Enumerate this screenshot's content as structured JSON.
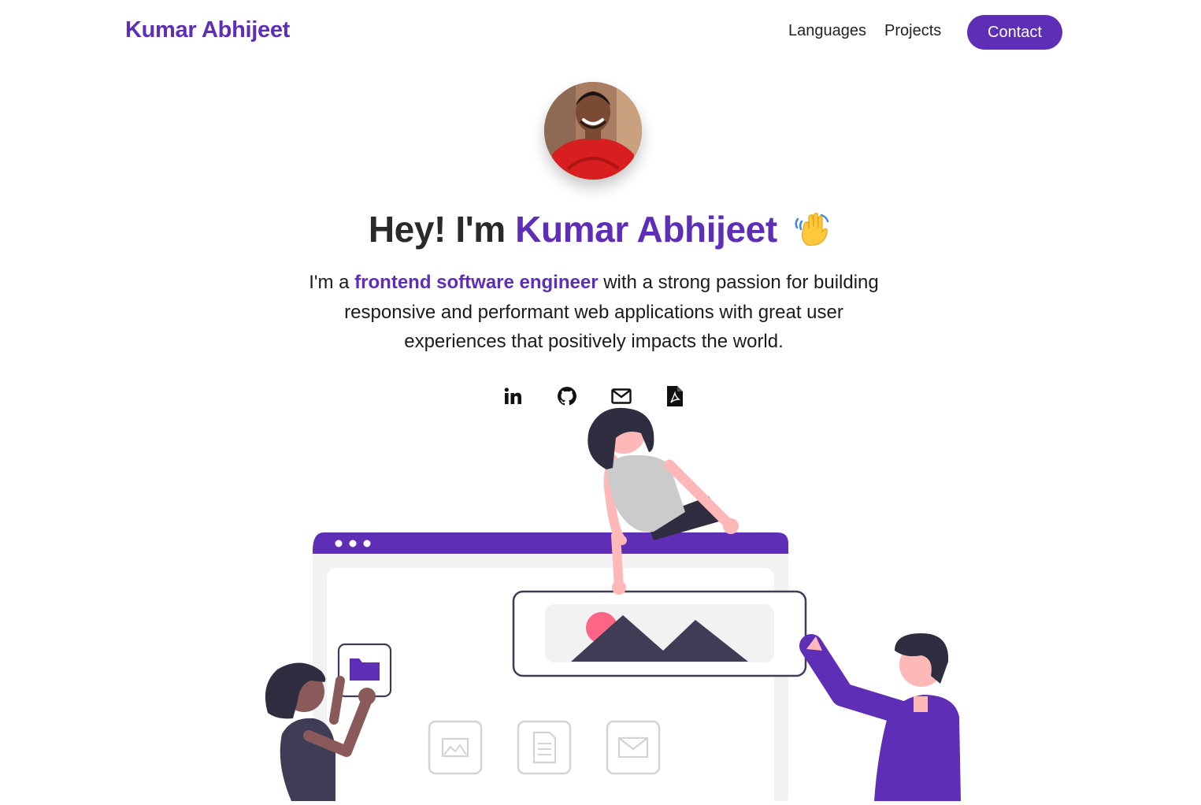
{
  "header": {
    "brand": "Kumar Abhijeet",
    "nav": {
      "languages": "Languages",
      "projects": "Projects",
      "contact": "Contact"
    }
  },
  "hero": {
    "greeting": "Hey! I'm",
    "name": "Kumar Abhijeet",
    "wave_emoji": "👋",
    "intro_prefix": "I'm a ",
    "intro_highlight": "frontend software engineer",
    "intro_suffix": " with a strong passion for building responsive and performant web applications with great user experiences that positively impacts the world."
  },
  "social_icons": [
    "linkedin-icon",
    "github-icon",
    "mail-icon",
    "pdf-resume-icon"
  ],
  "colors": {
    "accent": "#5f2eb6",
    "text": "#222222",
    "background": "#ffffff"
  }
}
